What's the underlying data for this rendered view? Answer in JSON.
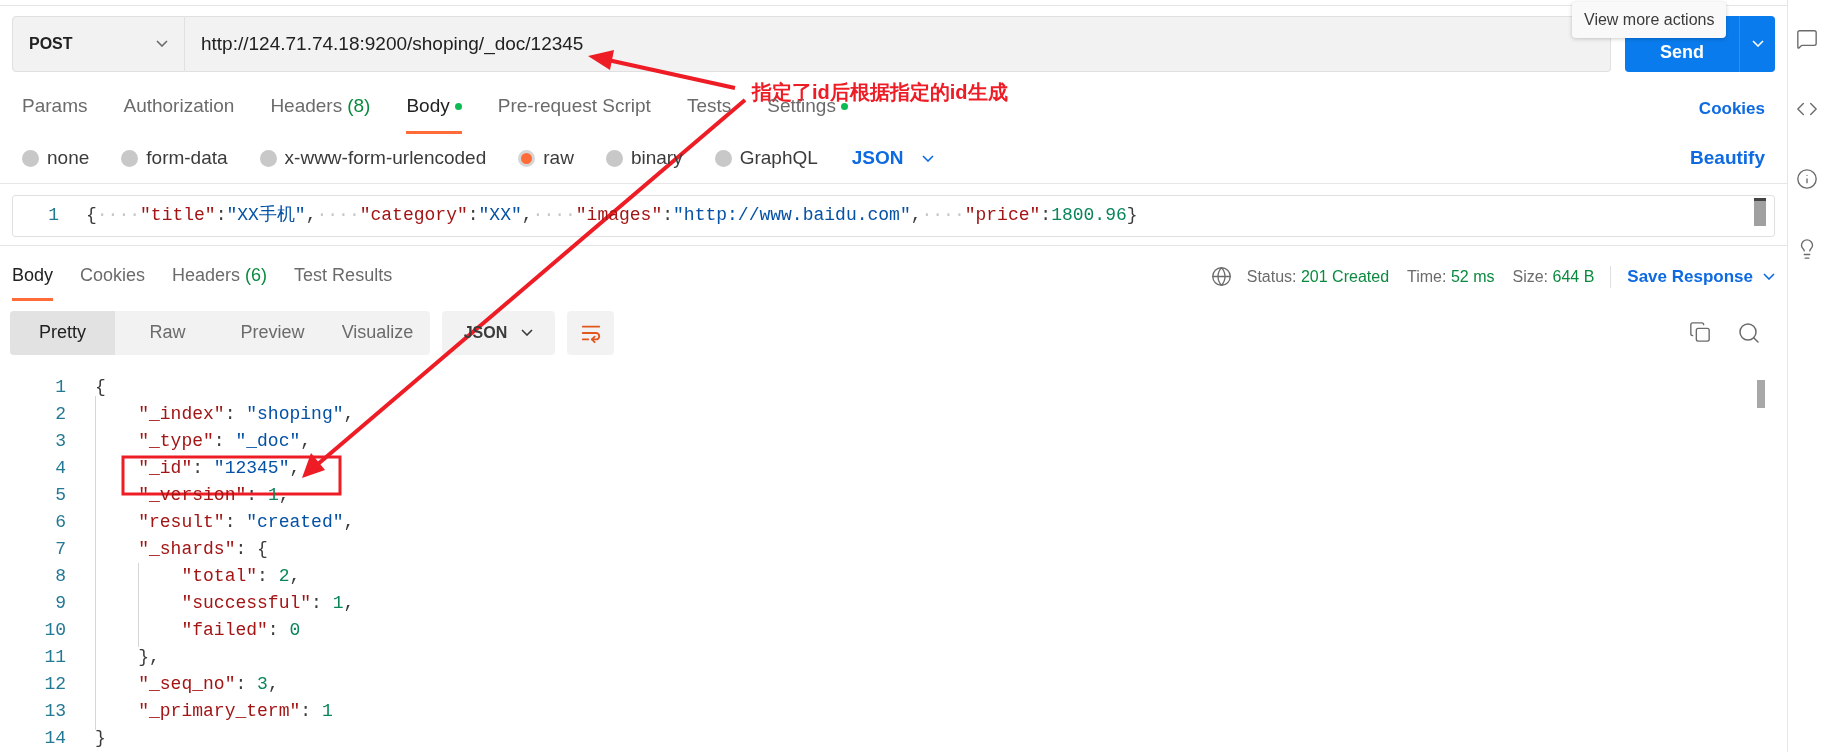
{
  "request": {
    "method": "POST",
    "url": "http://124.71.74.18:9200/shoping/_doc/12345",
    "send": "Send",
    "tooltip": "View more actions"
  },
  "request_tabs": [
    {
      "label": "Params",
      "dot": false,
      "selected": false
    },
    {
      "label": "Authorization",
      "dot": false,
      "selected": false
    },
    {
      "label": "Headers",
      "count": "(8)",
      "dot": false,
      "selected": false
    },
    {
      "label": "Body",
      "dot": true,
      "selected": true
    },
    {
      "label": "Pre-request Script",
      "dot": false,
      "selected": false
    },
    {
      "label": "Tests",
      "dot": false,
      "selected": false
    },
    {
      "label": "Settings",
      "dot": true,
      "selected": false
    }
  ],
  "cookies_link": "Cookies",
  "body_types": [
    {
      "label": "none",
      "selected": false
    },
    {
      "label": "form-data",
      "selected": false
    },
    {
      "label": "x-www-form-urlencoded",
      "selected": false
    },
    {
      "label": "raw",
      "selected": true
    },
    {
      "label": "binary",
      "selected": false
    },
    {
      "label": "GraphQL",
      "selected": false
    }
  ],
  "body_language": "JSON",
  "beautify": "Beautify",
  "request_body": [
    {
      "number": "1",
      "text": "{····\"title\":\"XX手机\",····\"category\":\"XX\",····\"images\":\"http://www.baidu.com\",····\"price\":1800.96}"
    }
  ],
  "response_tabs": [
    {
      "label": "Body",
      "selected": true
    },
    {
      "label": "Cookies",
      "selected": false
    },
    {
      "label": "Headers",
      "count": "(6)",
      "selected": false
    },
    {
      "label": "Test Results",
      "selected": false
    }
  ],
  "metrics": [
    {
      "label": "Status:",
      "value": "201 Created"
    },
    {
      "label": "Time:",
      "value": "52 ms"
    },
    {
      "label": "Size:",
      "value": "644 B"
    }
  ],
  "save_response": "Save Response",
  "view_modes": [
    {
      "label": "Pretty",
      "selected": true
    },
    {
      "label": "Raw",
      "selected": false
    },
    {
      "label": "Preview",
      "selected": false
    },
    {
      "label": "Visualize",
      "selected": false
    }
  ],
  "response_format": "JSON",
  "response_body": [
    {
      "number": "1",
      "text": "{"
    },
    {
      "number": "2",
      "text": "    \"_index\": \"shoping\","
    },
    {
      "number": "3",
      "text": "    \"_type\": \"_doc\","
    },
    {
      "number": "4",
      "text": "    \"_id\": \"12345\","
    },
    {
      "number": "5",
      "text": "    \"_version\": 1,"
    },
    {
      "number": "6",
      "text": "    \"result\": \"created\","
    },
    {
      "number": "7",
      "text": "    \"_shards\": {"
    },
    {
      "number": "8",
      "text": "        \"total\": 2,"
    },
    {
      "number": "9",
      "text": "        \"successful\": 1,"
    },
    {
      "number": "10",
      "text": "        \"failed\": 0"
    },
    {
      "number": "11",
      "text": "    },"
    },
    {
      "number": "12",
      "text": "    \"_seq_no\": 3,"
    },
    {
      "number": "13",
      "text": "    \"_primary_term\": 1"
    },
    {
      "number": "14",
      "text": "}"
    }
  ],
  "annotation": {
    "text": "指定了id后根据指定的id生成"
  }
}
